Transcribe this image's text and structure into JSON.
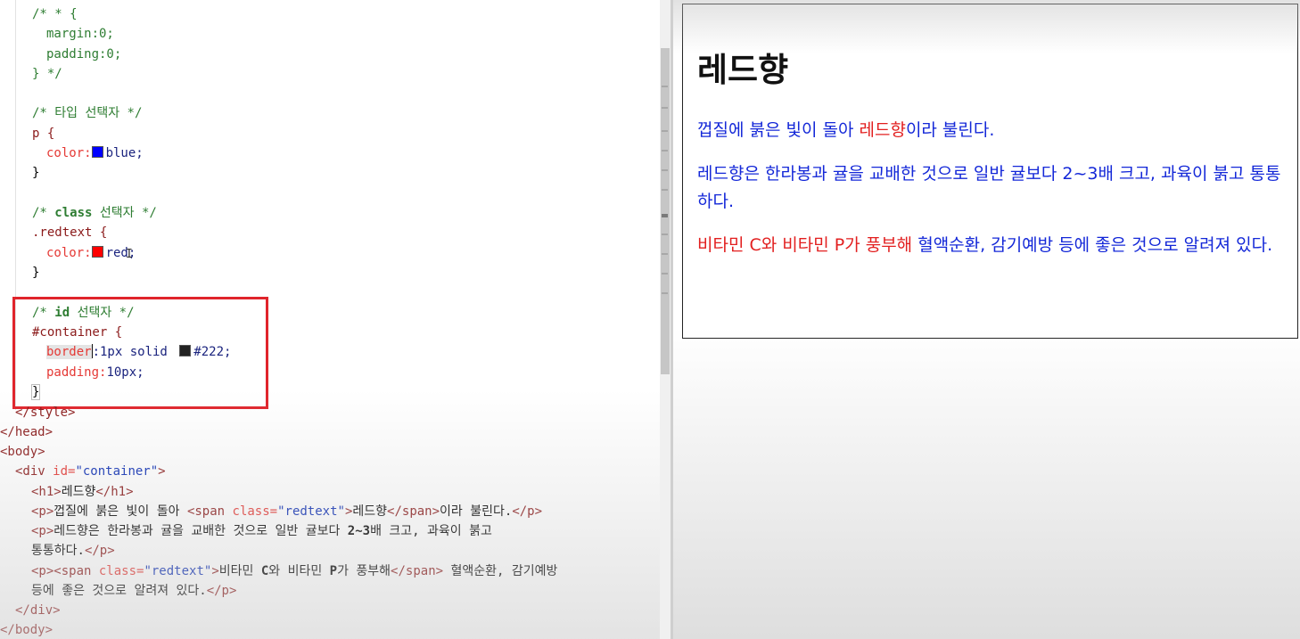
{
  "editor": {
    "css_block": {
      "reset_comment_open": "/* * {",
      "margin_decl": "margin:0;",
      "padding_decl": "padding:0;",
      "reset_comment_close": "} */",
      "type_comment": "/* 타입 선택자 */",
      "p_selector": "p {",
      "color_prop": "color:",
      "blue_value": "blue;",
      "close_brace": "}",
      "class_comment_open": "/* ",
      "class_comment_kw": "class",
      "class_comment_rest": " 선택자 */",
      "redtext_selector": ".redtext {",
      "red_value": "red;",
      "id_comment_open": "/* ",
      "id_comment_kw": "id",
      "id_comment_rest": " 선택자 */",
      "container_selector": "#container {",
      "border_prop": "border",
      "border_value_1": ":1px solid ",
      "border_value_2": "#222;",
      "padding_prop": "padding:",
      "padding_value": "10px;"
    },
    "html_block": {
      "style_close": "</style>",
      "head_close": "</head>",
      "body_open": "<body>",
      "div_open_1": "<div ",
      "div_attr": "id=",
      "div_val": "\"container\"",
      "div_open_2": ">",
      "h1_open": "<h1>",
      "h1_text": "레드향",
      "h1_close": "</h1>",
      "p_open": "<p>",
      "p_close": "</p>",
      "p1_text_a": "껍질에 붉은 빛이 돌아 ",
      "span_open_1": "<span ",
      "span_attr": "class=",
      "span_val": "\"redtext\"",
      "span_open_2": ">",
      "p1_span_text": "레드향",
      "span_close": "</span>",
      "p1_text_b": "이라 불린다.",
      "p2_text_a1": "레드향은 한라봉과 귤을 교배한 것으로 일반 귤보다 ",
      "p2_text_a2": "2~3",
      "p2_text_a3": "배 크고, 과육이 붉고",
      "p2_text_b": "통통하다.",
      "p3_span_text_a1": "비타민 ",
      "p3_span_text_a2": "C",
      "p3_span_text_a3": "와 비타민 ",
      "p3_span_text_a4": "P",
      "p3_span_text_a5": "가 풍부해",
      "p3_text_a": " 혈액순환, 감기예방",
      "p3_text_b": "등에 좋은 것으로 알려져 있다.",
      "div_close": "</div>",
      "body_close": "</body>"
    },
    "colors": {
      "blue_swatch": "#0000ff",
      "red_swatch": "#ff0000",
      "dark_swatch": "#222222"
    }
  },
  "preview": {
    "heading": "레드향",
    "p1_a": "껍질에 붉은 빛이 돌아 ",
    "p1_red": "레드향",
    "p1_b": "이라 불린다.",
    "p2": "레드향은 한라봉과 귤을 교배한 것으로 일반 귤보다 2~3배 크고, 과육이 붉고 통통하다.",
    "p3_red": "비타민 C와 비타민 P가 풍부해",
    "p3_b": " 혈액순환, 감기예방 등에 좋은 것으로 알려져 있다.",
    "colors": {
      "text_blue": "#1428d8",
      "text_red": "#e21f1f",
      "border": "#222222",
      "highlight_box": "#e0242b"
    }
  }
}
